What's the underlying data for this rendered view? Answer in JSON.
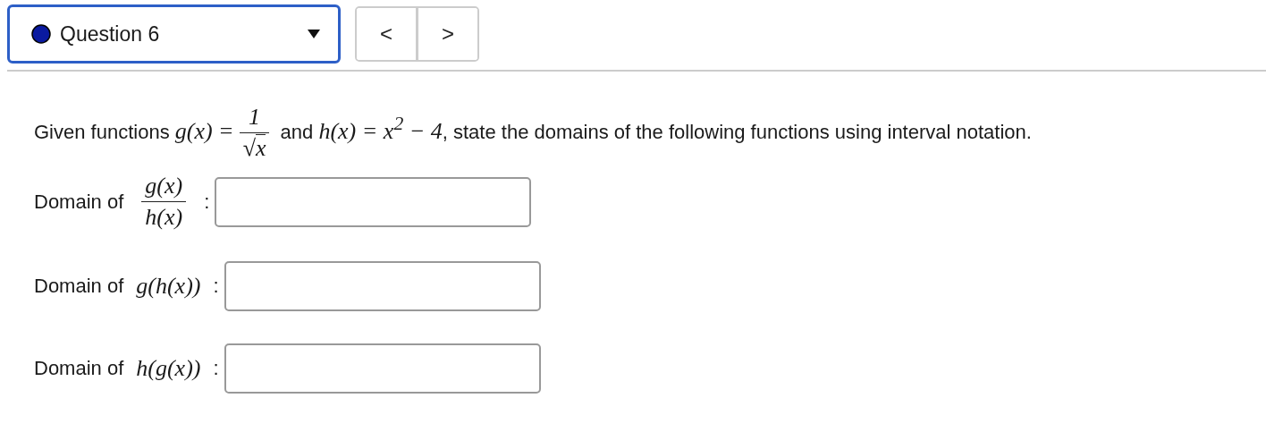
{
  "question_selector": {
    "label": "Question 6"
  },
  "navigation": {
    "previous": "<",
    "next": ">"
  },
  "prompt": [
    {
      "kind": "text",
      "text": "Given functions "
    },
    {
      "kind": "math",
      "text": "g(x) ="
    },
    {
      "kind": "frac",
      "numerator": "1",
      "radical": "√",
      "radicand": "x"
    },
    {
      "kind": "text",
      "text": " and "
    },
    {
      "kind": "math",
      "text": "h(x) = x$^{2}$ − 4"
    },
    {
      "kind": "text",
      "text": ", state the domains of the following functions using interval notation."
    }
  ],
  "answers": [
    {
      "label": "Domain of",
      "kind": "frac",
      "numerator": "g(x)",
      "denominator": "h(x)",
      "colon": ":"
    },
    {
      "label": "Domain of",
      "kind": "math",
      "expression": "g(h(x))",
      "colon": ":"
    },
    {
      "label": "Domain of",
      "kind": "math",
      "expression": "h(g(x))",
      "colon": ":"
    }
  ]
}
